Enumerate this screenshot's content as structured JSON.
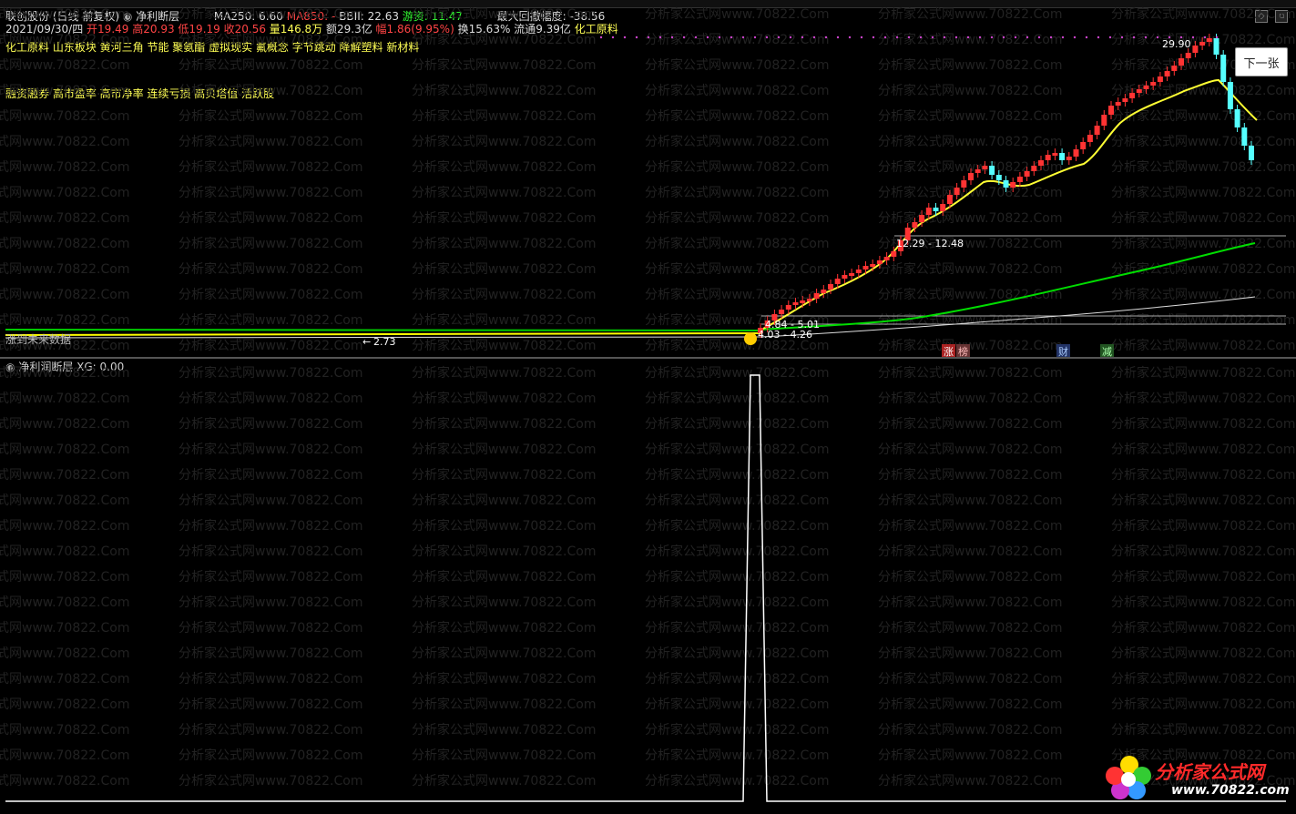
{
  "header": {
    "stock_name": "联创股份",
    "period": "(日线 前复权)",
    "indicator_main": "净利断层",
    "ma250_label": "MA250: 6.60",
    "ma850_label": "MA850: -",
    "bbii_label": "BBII: 22.63",
    "youzi_label": "游资: 11.47",
    "max_drawdown_label": "最大回撤幅度: -38.56"
  },
  "quote": {
    "date": "2021/09/30/四",
    "open": "开19.49",
    "high": "高20.93",
    "low": "低19.19",
    "close": "收20.56",
    "volume": "量146.8万",
    "amount": "额29.3亿",
    "change": "幅1.86(9.95%)",
    "turnover": "换15.63%",
    "float": "流通9.39亿",
    "sector": "化工原料"
  },
  "tags": {
    "line1": "化工原料 山东板块 黄河三角 节能 聚氨酯 虚拟现实 氟概念 字节跳动 降解塑料 新材料",
    "line2": "融资融券 高市盈率 高市净率 连续亏损 高贝塔值 活跃股"
  },
  "chart_annotations": {
    "high_price": "29.90",
    "range_upper": "12.29 - 12.48",
    "range_mid": "4.84 - 5.01",
    "range_low": "4.03 - 4.26",
    "low_price": "2.73",
    "left_note": "涨到未来数据",
    "badge_zhang": "涨",
    "badge_bang": "榜",
    "badge_cai": "财",
    "badge_jian": "减"
  },
  "indicator": {
    "title": "净利润断层",
    "xg_label": "XG: 0.00"
  },
  "buttons": {
    "next_label": "下一张"
  },
  "watermark": {
    "text": "分析家公式网www.70822.Com"
  },
  "logo": {
    "name": "分析家公式网",
    "url": "www.70822.com"
  },
  "colors": {
    "up": "#ff3333",
    "down": "#55ffff",
    "ma_short": "#ffff00",
    "ma_green": "#00ff00",
    "ma_white": "#ffffff"
  }
}
